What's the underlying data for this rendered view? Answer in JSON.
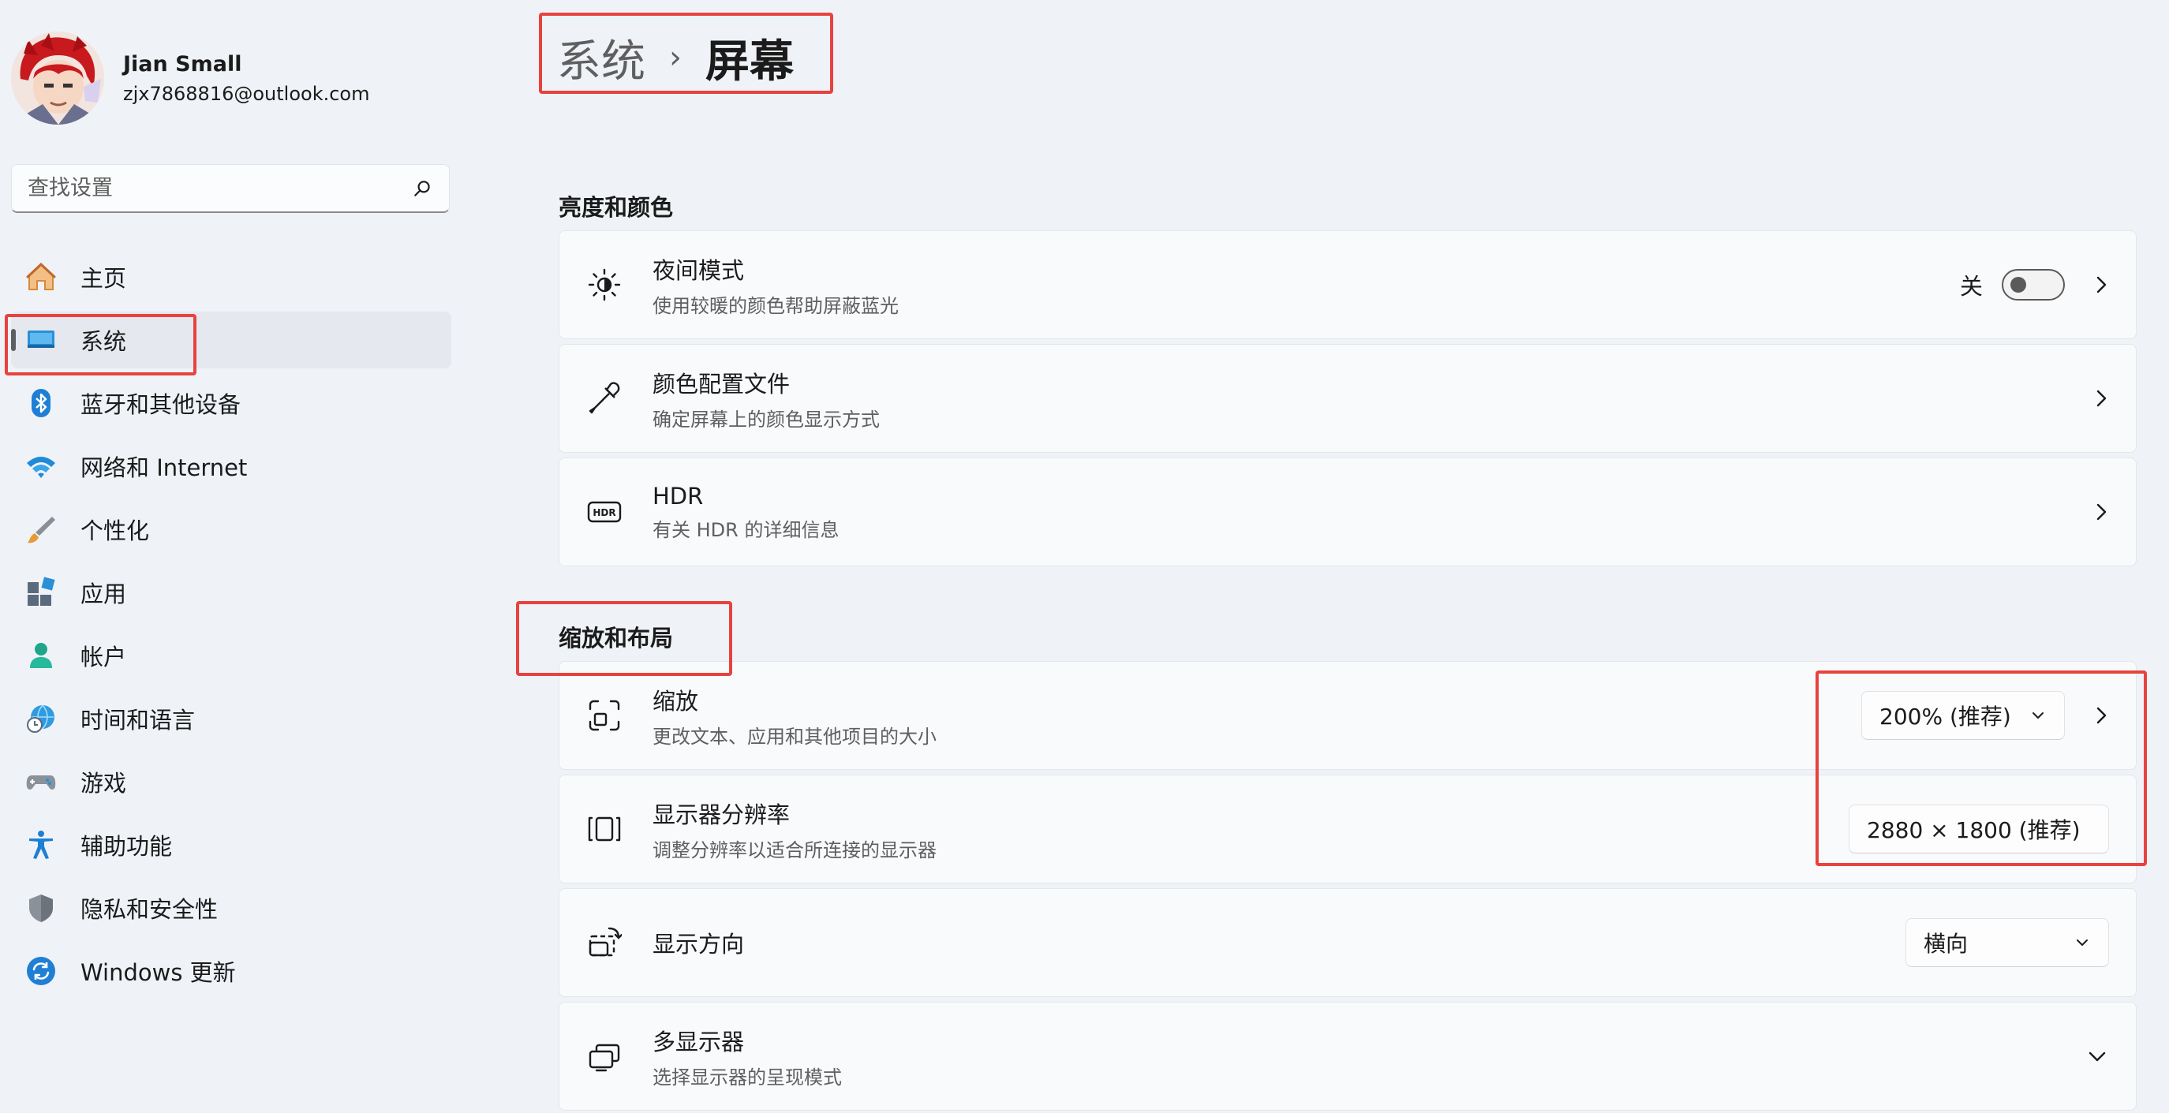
{
  "user": {
    "name": "Jian Small",
    "email": "zjx7868816@outlook.com"
  },
  "search": {
    "placeholder": "查找设置"
  },
  "nav": [
    {
      "label": "主页",
      "icon": "home-icon"
    },
    {
      "label": "系统",
      "icon": "system-display-icon",
      "selected": true
    },
    {
      "label": "蓝牙和其他设备",
      "icon": "bluetooth-icon"
    },
    {
      "label": "网络和 Internet",
      "icon": "wifi-icon"
    },
    {
      "label": "个性化",
      "icon": "paintbrush-icon"
    },
    {
      "label": "应用",
      "icon": "apps-icon"
    },
    {
      "label": "帐户",
      "icon": "account-icon"
    },
    {
      "label": "时间和语言",
      "icon": "globe-clock-icon"
    },
    {
      "label": "游戏",
      "icon": "gamepad-icon"
    },
    {
      "label": "辅助功能",
      "icon": "accessibility-icon"
    },
    {
      "label": "隐私和安全性",
      "icon": "shield-icon"
    },
    {
      "label": "Windows 更新",
      "icon": "update-icon"
    }
  ],
  "breadcrumb": {
    "parent": "系统",
    "separator": "›",
    "current": "屏幕"
  },
  "sections": {
    "brightness": {
      "title": "亮度和颜色",
      "night_light": {
        "title": "夜间模式",
        "subtitle": "使用较暖的颜色帮助屏蔽蓝光",
        "state": "关"
      },
      "color_profile": {
        "title": "颜色配置文件",
        "subtitle": "确定屏幕上的颜色显示方式"
      },
      "hdr": {
        "title": "HDR",
        "subtitle": "有关 HDR 的详细信息"
      }
    },
    "scale_layout": {
      "title": "缩放和布局",
      "scale": {
        "title": "缩放",
        "subtitle": "更改文本、应用和其他项目的大小",
        "value": "200% (推荐)"
      },
      "resolution": {
        "title": "显示器分辨率",
        "subtitle": "调整分辨率以适合所连接的显示器",
        "value": "2880 × 1800 (推荐)"
      },
      "orientation": {
        "title": "显示方向",
        "value": "横向"
      },
      "multi_display": {
        "title": "多显示器",
        "subtitle": "选择显示器的呈现模式"
      }
    }
  },
  "colors": {
    "highlight": "#e8423f",
    "accent": "#0067c0"
  }
}
